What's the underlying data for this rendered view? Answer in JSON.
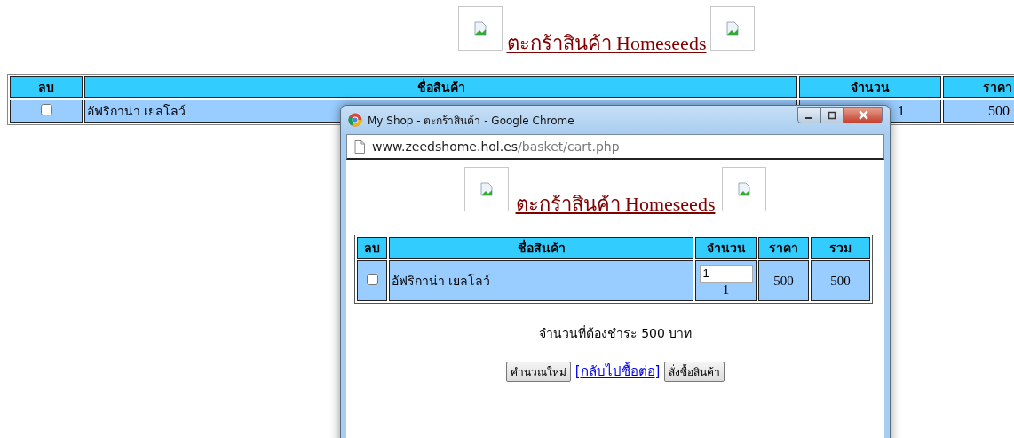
{
  "page": {
    "title": "ตะกร้าสินค้า Homeseeds",
    "table": {
      "columns": [
        "ลบ",
        "ชื่อสินค้า",
        "จำนวน",
        "ราคา"
      ],
      "rows": [
        {
          "checked": false,
          "name": "อัฟริกาน่า เยลโลว์",
          "quantity": "1",
          "price": "500"
        }
      ]
    }
  },
  "popup": {
    "title": "My Shop - ตะกร้าสินค้า - Google Chrome",
    "url_host": "www.zeedshome.hol.es",
    "url_path": "/basket/cart.php",
    "page": {
      "title": "ตะกร้าสินค้า Homeseeds",
      "table": {
        "columns": [
          "ลบ",
          "ชื่อสินค้า",
          "จำนวน",
          "ราคา",
          "รวม"
        ],
        "rows": [
          {
            "checked": false,
            "name": "อัฟริกาน่า เยลโลว์",
            "quantity_input": "1",
            "quantity": "1",
            "price": "500",
            "total": "500"
          }
        ]
      },
      "summary": "จำนวนที่ต้องชำระ 500 บาท",
      "actions": [
        {
          "kind": "button",
          "label": "คำนวณใหม่"
        },
        {
          "kind": "text",
          "label": "["
        },
        {
          "kind": "link",
          "label": "กลับไปซื้อต่อ"
        },
        {
          "kind": "text",
          "label": "]"
        },
        {
          "kind": "button",
          "label": "สั่งซื้อสินค้า"
        }
      ]
    }
  }
}
